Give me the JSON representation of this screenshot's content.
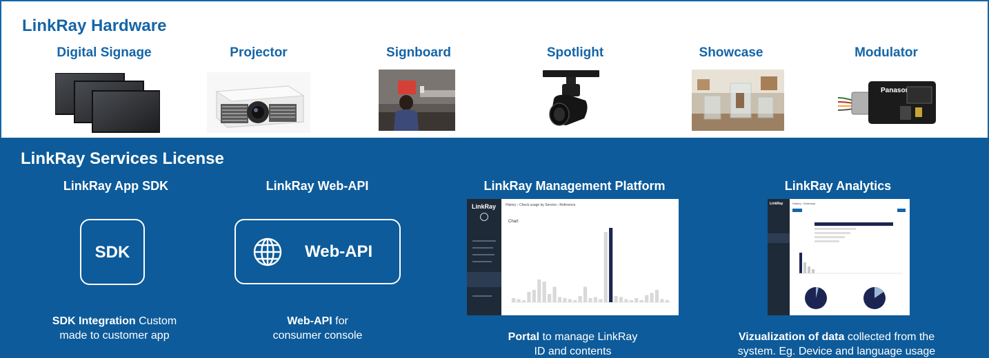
{
  "hardware": {
    "title": "LinkRay Hardware",
    "items": [
      {
        "label": "Digital Signage",
        "icon": "digital-signage-panels"
      },
      {
        "label": "Projector",
        "icon": "projector"
      },
      {
        "label": "Signboard",
        "icon": "signboard-photo"
      },
      {
        "label": "Spotlight",
        "icon": "spotlight"
      },
      {
        "label": "Showcase",
        "icon": "showcase-photo"
      },
      {
        "label": "Modulator",
        "icon": "modulator-device"
      }
    ]
  },
  "services": {
    "title": "LinkRay Services License",
    "items": [
      {
        "label": "LinkRay App SDK",
        "icon_text": "SDK",
        "desc_bold": "SDK Integration",
        "desc_rest_1": " Custom",
        "desc_rest_2": "made to customer app"
      },
      {
        "label": "LinkRay Web-API",
        "icon_text": "Web-API",
        "desc_bold": "Web-API",
        "desc_rest_1": " for",
        "desc_rest_2": "consumer console"
      },
      {
        "label": "LinkRay Management Platform",
        "desc_bold": "Portal",
        "desc_rest_1": " to manage LinkRay",
        "desc_rest_2": "ID and contents"
      },
      {
        "label": "LinkRay Analytics",
        "desc_bold": "Vizualization of data",
        "desc_rest_1": " collected from the",
        "desc_rest_2": "system. Eg. Device and language usage"
      }
    ]
  },
  "portal_screenshot": {
    "brand": "LinkRay",
    "header": "History › Check usage by Service › Reference",
    "chart_title": "Chart",
    "chart_data": {
      "type": "bar",
      "values": [
        4,
        3,
        2,
        10,
        12,
        22,
        20,
        8,
        15,
        5,
        4,
        3,
        2,
        6,
        15,
        4,
        5,
        3,
        68,
        72,
        6,
        5,
        3,
        2,
        4,
        2,
        7,
        9,
        12,
        3,
        2
      ]
    }
  },
  "analytics_screenshot": {
    "brand": "LinkRay",
    "header": "History › Summary"
  },
  "colors": {
    "brand_blue": "#1565a7",
    "band_blue": "#0d5b9a",
    "dark_sidebar": "#1f2a38",
    "highlight_bar": "#1c2552"
  }
}
